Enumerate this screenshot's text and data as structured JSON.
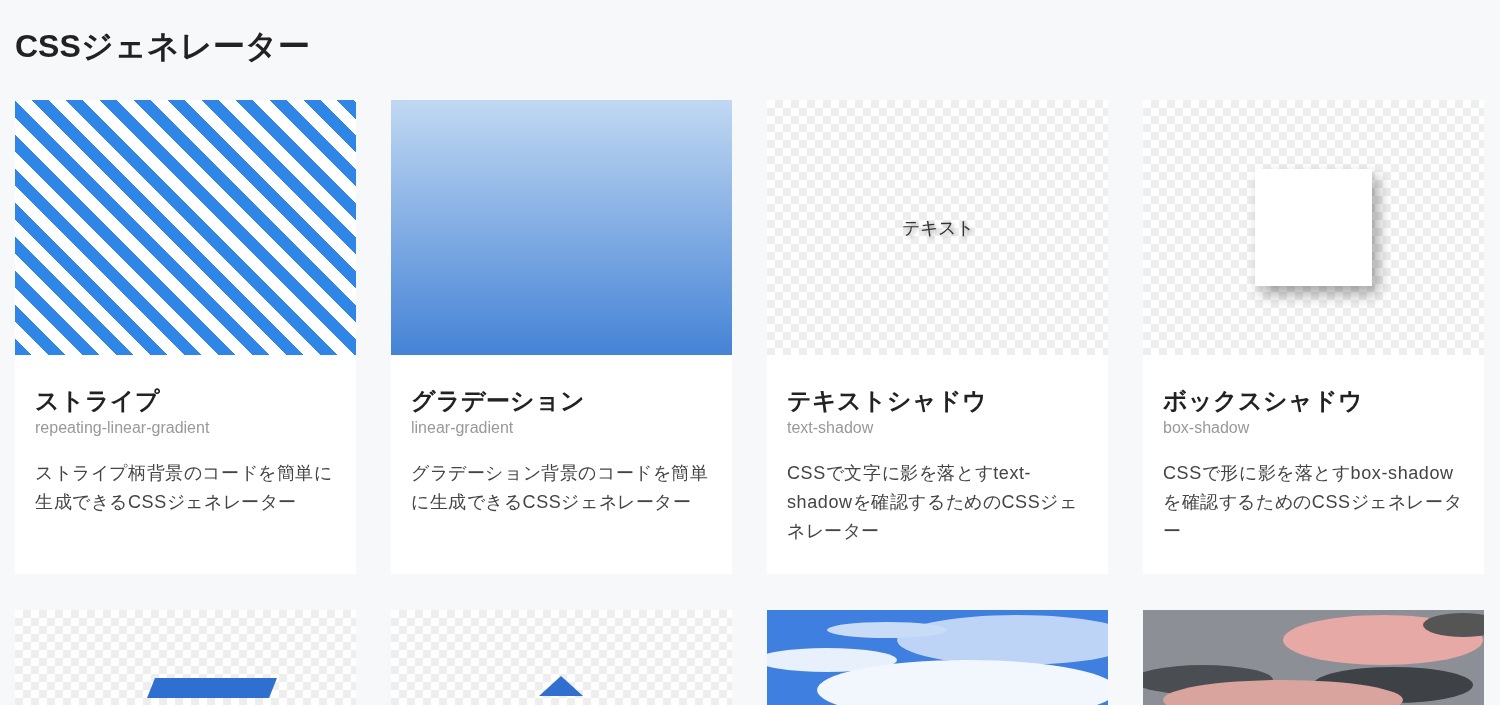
{
  "page_title": "CSSジェネレーター",
  "cards": [
    {
      "kind": "stripe",
      "title": "ストライプ",
      "subtitle": "repeating-linear-gradient",
      "description": "ストライプ柄背景のコードを簡単に生成できるCSSジェネレーター"
    },
    {
      "kind": "gradient",
      "title": "グラデーション",
      "subtitle": "linear-gradient",
      "description": "グラデーション背景のコードを簡単に生成できるCSSジェネレーター"
    },
    {
      "kind": "text-shadow",
      "preview_text": "テキスト",
      "title": "テキストシャドウ",
      "subtitle": "text-shadow",
      "description": "CSSで文字に影を落とすtext-shadowを確認するためのCSSジェネレーター"
    },
    {
      "kind": "box-shadow",
      "title": "ボックスシャドウ",
      "subtitle": "box-shadow",
      "description": "CSSで形に影を落とすbox-shadowを確認するためのCSSジェネレーター"
    },
    {
      "kind": "parallelogram"
    },
    {
      "kind": "triangle"
    },
    {
      "kind": "sky"
    },
    {
      "kind": "sunset"
    }
  ]
}
